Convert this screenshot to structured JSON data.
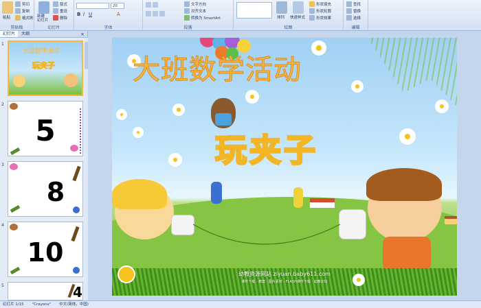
{
  "ribbon": {
    "clipboard": {
      "paste": "粘贴",
      "cut": "剪切",
      "copy": "复制",
      "format_painter": "格式刷",
      "label": "剪贴板"
    },
    "slides": {
      "new_slide": "新建\n幻灯片",
      "layout": "版式",
      "reset": "重设",
      "delete": "删除",
      "label": "幻灯片"
    },
    "font": {
      "size": "20",
      "label": "字体"
    },
    "paragraph": {
      "text_direction": "文字方向",
      "align_text": "对齐文本",
      "smartart": "转换为 SmartArt",
      "label": "段落"
    },
    "drawing": {
      "arrange": "排列",
      "quick_styles": "快速样式",
      "shape_fill": "形状填充",
      "shape_outline": "形状轮廓",
      "shape_effects": "形状效果",
      "label": "绘图"
    },
    "editing": {
      "find": "查找",
      "replace": "替换",
      "select": "选择",
      "label": "编辑"
    }
  },
  "left_pane": {
    "tabs": [
      "幻灯片",
      "大纲"
    ],
    "close": "×",
    "slides": [
      {
        "num": "1",
        "big": ""
      },
      {
        "num": "2",
        "big": "5"
      },
      {
        "num": "3",
        "big": "8"
      },
      {
        "num": "4",
        "big": "10"
      },
      {
        "num": "5",
        "big": "4"
      }
    ]
  },
  "slide": {
    "title": "大班数学活动",
    "subtitle": "玩夹子",
    "footer": "幼教资源网站 ziyuan.baby611.com",
    "footer_small": "课件下载 · 教案 · 图片素材 · FLASH课件下载 · 幼教论坛"
  },
  "status": {
    "slide_counter": "幻灯片 1/15",
    "theme": "\"Crayons\"",
    "language": "中文(简体，中国)"
  },
  "colors": {
    "accent": "#f5b841",
    "ribbon": "#d4e1f3",
    "selection": "#f4b93a"
  }
}
